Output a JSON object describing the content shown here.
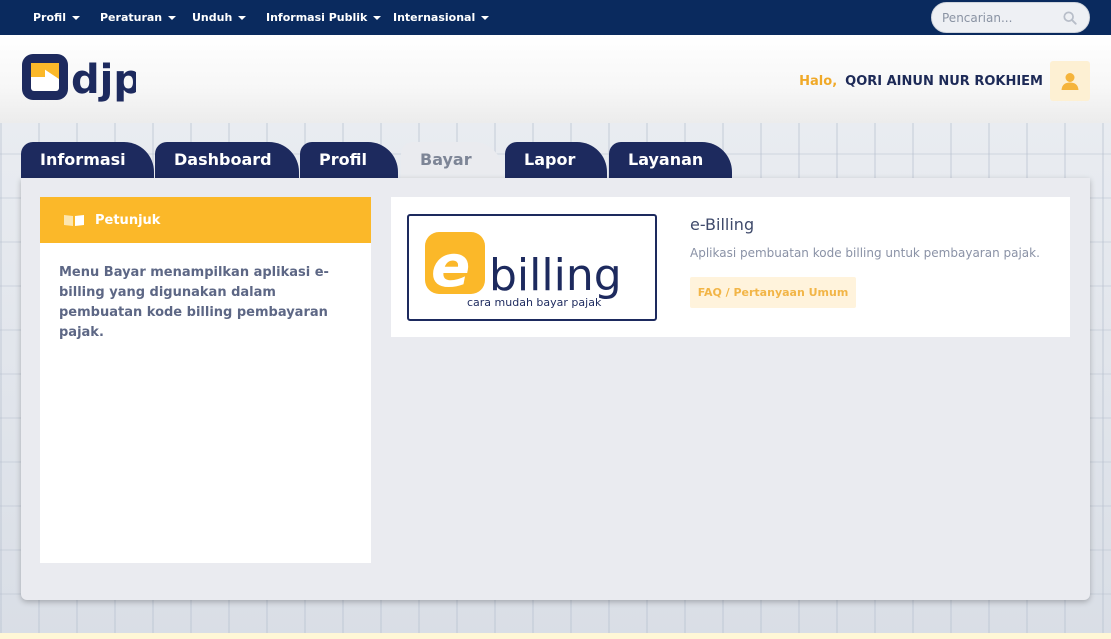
{
  "topnav": {
    "items": [
      {
        "label": "Profil"
      },
      {
        "label": "Peraturan"
      },
      {
        "label": "Unduh"
      },
      {
        "label": "Informasi Publik"
      },
      {
        "label": "Internasional"
      }
    ],
    "search_placeholder": "Pencarian..."
  },
  "header": {
    "logo_text": "djp",
    "greeting": "Halo,",
    "user_name": "QORI AINUN NUR ROKHIEM"
  },
  "tabs": [
    {
      "label": "Informasi",
      "active": false
    },
    {
      "label": "Dashboard",
      "active": false
    },
    {
      "label": "Profil",
      "active": false
    },
    {
      "label": "Bayar",
      "active": true
    },
    {
      "label": "Lapor",
      "active": false
    },
    {
      "label": "Layanan",
      "active": false
    }
  ],
  "petunjuk": {
    "title": "Petunjuk",
    "body": "Menu Bayar menampilkan aplikasi e-billing yang digunakan dalam pembuatan kode billing pembayaran pajak."
  },
  "app": {
    "logo_letter": "e",
    "logo_word": "billing",
    "logo_tagline": "cara mudah bayar pajak",
    "title": "e-Billing",
    "description": "Aplikasi pembuatan kode billing untuk pembayaran pajak.",
    "faq_label": "FAQ / Pertanyaan Umum"
  },
  "colors": {
    "navy": "#0a2a5e",
    "tab_navy": "#1d2a5e",
    "accent_yellow": "#fbb829",
    "greeting_orange": "#f0a928"
  }
}
